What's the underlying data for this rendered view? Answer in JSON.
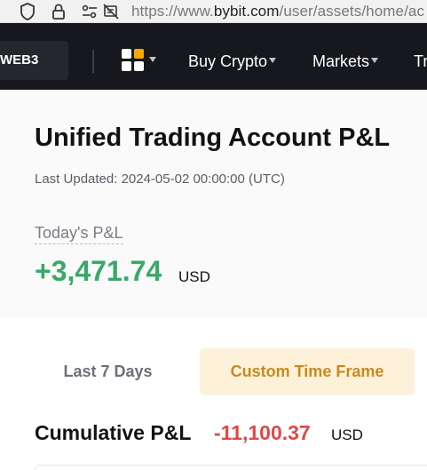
{
  "browser": {
    "url_prefix": "https://www.",
    "url_host": "bybit.com",
    "url_path": "/user/assets/home/ac",
    "icons": [
      "shield-icon",
      "lock-icon",
      "site-settings-icon",
      "notifications-blocked-icon"
    ]
  },
  "nav": {
    "web3_label": "WEB3",
    "items": [
      {
        "label": "Buy Crypto"
      },
      {
        "label": "Markets"
      },
      {
        "label": "Tr"
      }
    ],
    "apps_icon_colors": [
      "#ffffff",
      "#f7a600",
      "#ffffff",
      "#ffffff"
    ]
  },
  "page": {
    "title": "Unified Trading Account P&L",
    "last_updated": "Last Updated: 2024-05-02 00:00:00 (UTC)",
    "today_label": "Today's P&L",
    "today_value": "+3,471.74",
    "today_unit": "USD",
    "tabs": [
      {
        "label": "Last 7 Days",
        "active": false
      },
      {
        "label": "Custom Time Frame",
        "active": true
      }
    ],
    "cumulative_label": "Cumulative P&L",
    "cumulative_value": "-11,100.37",
    "cumulative_unit": "USD"
  },
  "colors": {
    "profit": "#3aa86b",
    "loss": "#e04848",
    "accent": "#f7a600",
    "nav_bg": "#17181e"
  }
}
